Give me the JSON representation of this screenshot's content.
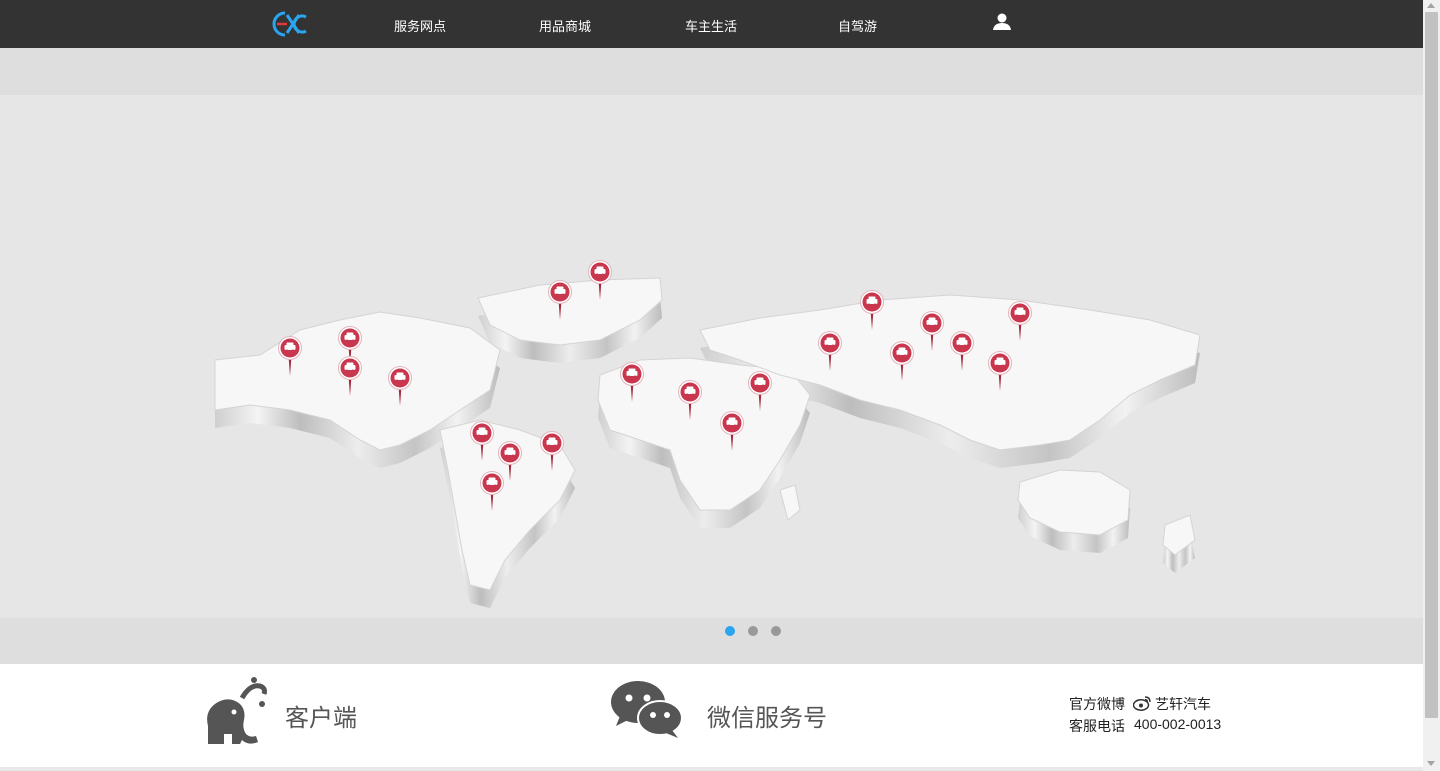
{
  "nav": {
    "items": [
      {
        "label": "服务网点"
      },
      {
        "label": "用品商城"
      },
      {
        "label": "车主生活"
      },
      {
        "label": "自驾游"
      }
    ]
  },
  "banner": {
    "slide_count": 3,
    "active_slide": 1,
    "accent_color": "#2aa5f0",
    "marker_color": "#c9374f"
  },
  "footer": {
    "client_label": "客户端",
    "wechat_label": "微信服务号",
    "weibo_label": "官方微博",
    "weibo_account": "艺轩汽车",
    "phone_label": "客服电话",
    "phone_number": "400-002-0013"
  }
}
